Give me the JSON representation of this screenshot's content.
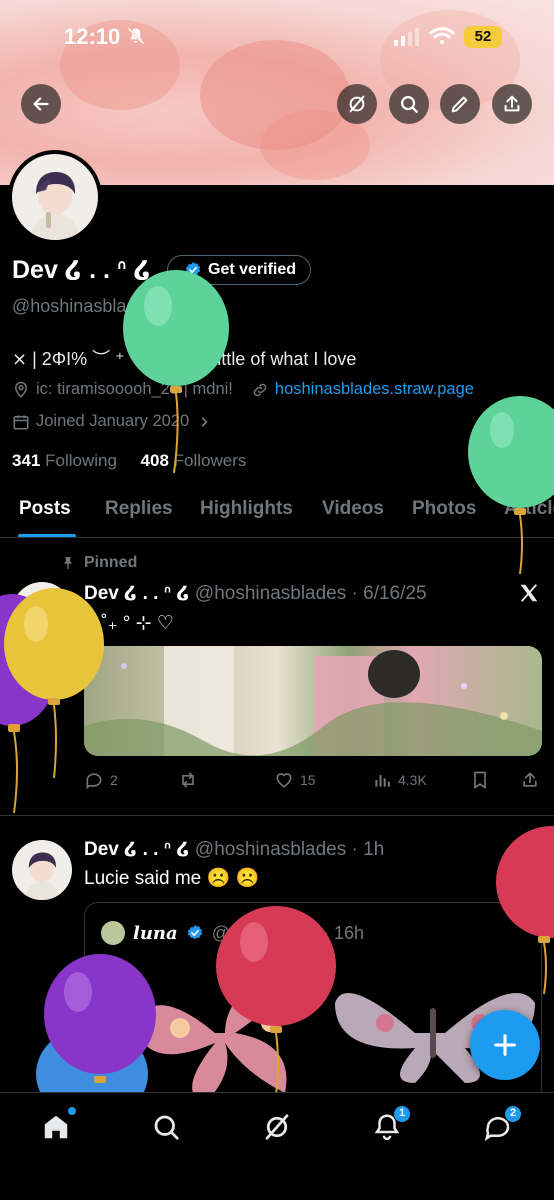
{
  "status_bar": {
    "time": "12:10",
    "battery": "52"
  },
  "profile": {
    "display_name": "Dev ໒ . . ᐢ ໒",
    "get_verified_label": "Get verified",
    "handle": "@hoshinasblades",
    "bio": "⨯ | 2ΦΙ% ︶ ⁺ ˚ ⋆ ɞ ˖ ⋆ a little of what I love",
    "location": "ic: tiramisooooh_25 | mdni!",
    "website": "hoshinasblades.straw.page",
    "joined": "Joined January 2020",
    "following_count": "341",
    "following_label": "Following",
    "followers_count": "408",
    "followers_label": "Followers"
  },
  "tabs": [
    "Posts",
    "Replies",
    "Highlights",
    "Videos",
    "Photos",
    "Articles"
  ],
  "pinned_post": {
    "pinned_label": "Pinned",
    "name": "Dev ໒ . . ᐢ ໒",
    "handle_time": "@hoshinasblades · 6/16/25",
    "text": "⋆ ˚₊ ° ⊹ ♡",
    "replies": "2",
    "likes": "15",
    "views": "4.3K"
  },
  "second_post": {
    "name": "Dev ໒ . . ᐢ ໒",
    "handle_time": "@hoshinasblades · 1h",
    "text": "Lucie said me ☹️ ☹️",
    "quote": {
      "name": "luna",
      "handle_time": "@naturaholic · 16h"
    }
  },
  "icons": {
    "back": "back-arrow-icon",
    "grok": "grok-icon",
    "search": "search-icon",
    "edit": "pencil-icon",
    "share": "share-icon",
    "home": "home-icon",
    "explore": "search-icon",
    "notifications": "bell-icon",
    "messages": "messages-icon",
    "compose": "plus-icon"
  },
  "nav_badges": {
    "notifications": "1",
    "messages": "2"
  },
  "colors": {
    "accent": "#1d9bf0",
    "background": "#000000",
    "muted": "#71767b",
    "battery": "#f4cc3b"
  }
}
